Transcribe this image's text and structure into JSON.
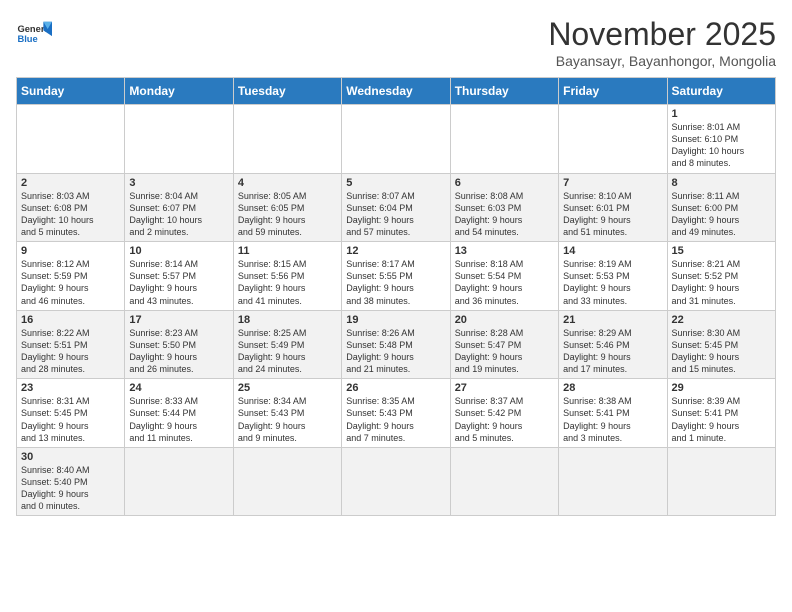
{
  "header": {
    "logo_general": "General",
    "logo_blue": "Blue",
    "title": "November 2025",
    "subtitle": "Bayansayr, Bayanhongor, Mongolia"
  },
  "days_of_week": [
    "Sunday",
    "Monday",
    "Tuesday",
    "Wednesday",
    "Thursday",
    "Friday",
    "Saturday"
  ],
  "weeks": [
    [
      {
        "day": "",
        "info": ""
      },
      {
        "day": "",
        "info": ""
      },
      {
        "day": "",
        "info": ""
      },
      {
        "day": "",
        "info": ""
      },
      {
        "day": "",
        "info": ""
      },
      {
        "day": "",
        "info": ""
      },
      {
        "day": "1",
        "info": "Sunrise: 8:01 AM\nSunset: 6:10 PM\nDaylight: 10 hours\nand 8 minutes."
      }
    ],
    [
      {
        "day": "2",
        "info": "Sunrise: 8:03 AM\nSunset: 6:08 PM\nDaylight: 10 hours\nand 5 minutes."
      },
      {
        "day": "3",
        "info": "Sunrise: 8:04 AM\nSunset: 6:07 PM\nDaylight: 10 hours\nand 2 minutes."
      },
      {
        "day": "4",
        "info": "Sunrise: 8:05 AM\nSunset: 6:05 PM\nDaylight: 9 hours\nand 59 minutes."
      },
      {
        "day": "5",
        "info": "Sunrise: 8:07 AM\nSunset: 6:04 PM\nDaylight: 9 hours\nand 57 minutes."
      },
      {
        "day": "6",
        "info": "Sunrise: 8:08 AM\nSunset: 6:03 PM\nDaylight: 9 hours\nand 54 minutes."
      },
      {
        "day": "7",
        "info": "Sunrise: 8:10 AM\nSunset: 6:01 PM\nDaylight: 9 hours\nand 51 minutes."
      },
      {
        "day": "8",
        "info": "Sunrise: 8:11 AM\nSunset: 6:00 PM\nDaylight: 9 hours\nand 49 minutes."
      }
    ],
    [
      {
        "day": "9",
        "info": "Sunrise: 8:12 AM\nSunset: 5:59 PM\nDaylight: 9 hours\nand 46 minutes."
      },
      {
        "day": "10",
        "info": "Sunrise: 8:14 AM\nSunset: 5:57 PM\nDaylight: 9 hours\nand 43 minutes."
      },
      {
        "day": "11",
        "info": "Sunrise: 8:15 AM\nSunset: 5:56 PM\nDaylight: 9 hours\nand 41 minutes."
      },
      {
        "day": "12",
        "info": "Sunrise: 8:17 AM\nSunset: 5:55 PM\nDaylight: 9 hours\nand 38 minutes."
      },
      {
        "day": "13",
        "info": "Sunrise: 8:18 AM\nSunset: 5:54 PM\nDaylight: 9 hours\nand 36 minutes."
      },
      {
        "day": "14",
        "info": "Sunrise: 8:19 AM\nSunset: 5:53 PM\nDaylight: 9 hours\nand 33 minutes."
      },
      {
        "day": "15",
        "info": "Sunrise: 8:21 AM\nSunset: 5:52 PM\nDaylight: 9 hours\nand 31 minutes."
      }
    ],
    [
      {
        "day": "16",
        "info": "Sunrise: 8:22 AM\nSunset: 5:51 PM\nDaylight: 9 hours\nand 28 minutes."
      },
      {
        "day": "17",
        "info": "Sunrise: 8:23 AM\nSunset: 5:50 PM\nDaylight: 9 hours\nand 26 minutes."
      },
      {
        "day": "18",
        "info": "Sunrise: 8:25 AM\nSunset: 5:49 PM\nDaylight: 9 hours\nand 24 minutes."
      },
      {
        "day": "19",
        "info": "Sunrise: 8:26 AM\nSunset: 5:48 PM\nDaylight: 9 hours\nand 21 minutes."
      },
      {
        "day": "20",
        "info": "Sunrise: 8:28 AM\nSunset: 5:47 PM\nDaylight: 9 hours\nand 19 minutes."
      },
      {
        "day": "21",
        "info": "Sunrise: 8:29 AM\nSunset: 5:46 PM\nDaylight: 9 hours\nand 17 minutes."
      },
      {
        "day": "22",
        "info": "Sunrise: 8:30 AM\nSunset: 5:45 PM\nDaylight: 9 hours\nand 15 minutes."
      }
    ],
    [
      {
        "day": "23",
        "info": "Sunrise: 8:31 AM\nSunset: 5:45 PM\nDaylight: 9 hours\nand 13 minutes."
      },
      {
        "day": "24",
        "info": "Sunrise: 8:33 AM\nSunset: 5:44 PM\nDaylight: 9 hours\nand 11 minutes."
      },
      {
        "day": "25",
        "info": "Sunrise: 8:34 AM\nSunset: 5:43 PM\nDaylight: 9 hours\nand 9 minutes."
      },
      {
        "day": "26",
        "info": "Sunrise: 8:35 AM\nSunset: 5:43 PM\nDaylight: 9 hours\nand 7 minutes."
      },
      {
        "day": "27",
        "info": "Sunrise: 8:37 AM\nSunset: 5:42 PM\nDaylight: 9 hours\nand 5 minutes."
      },
      {
        "day": "28",
        "info": "Sunrise: 8:38 AM\nSunset: 5:41 PM\nDaylight: 9 hours\nand 3 minutes."
      },
      {
        "day": "29",
        "info": "Sunrise: 8:39 AM\nSunset: 5:41 PM\nDaylight: 9 hours\nand 1 minute."
      }
    ],
    [
      {
        "day": "30",
        "info": "Sunrise: 8:40 AM\nSunset: 5:40 PM\nDaylight: 9 hours\nand 0 minutes."
      },
      {
        "day": "",
        "info": ""
      },
      {
        "day": "",
        "info": ""
      },
      {
        "day": "",
        "info": ""
      },
      {
        "day": "",
        "info": ""
      },
      {
        "day": "",
        "info": ""
      },
      {
        "day": "",
        "info": ""
      }
    ]
  ]
}
